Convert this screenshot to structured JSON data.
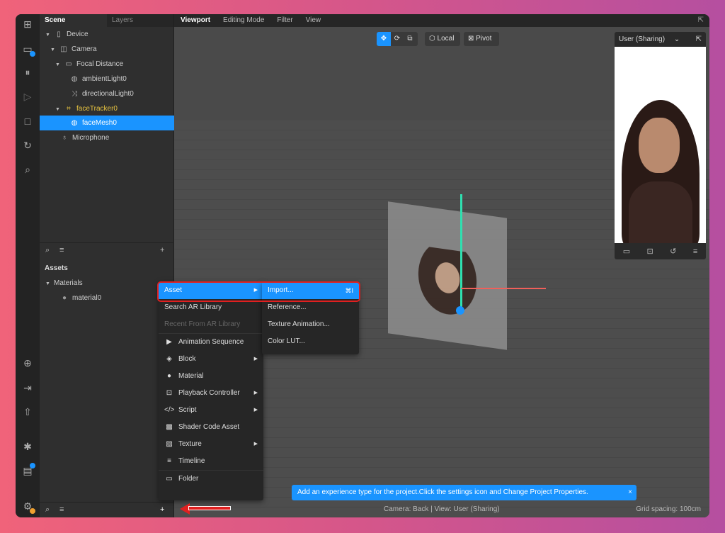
{
  "iconbar": {
    "icons": [
      "layout-icon",
      "camera-view-icon",
      "pause-icon",
      "step-play-icon",
      "square-icon",
      "refresh-icon",
      "search-icon",
      "add-folder-icon",
      "import-icon",
      "upload-icon",
      "bug-icon",
      "device-icon",
      "settings-icon"
    ],
    "accent": "#1a94ff",
    "warning": "#f0a030"
  },
  "scene": {
    "tabs": [
      "Scene",
      "Layers"
    ],
    "items": [
      {
        "label": "Device",
        "icon": "phone-icon"
      },
      {
        "label": "Camera",
        "icon": "camera-icon"
      },
      {
        "label": "Focal Distance",
        "icon": "ruler-icon"
      },
      {
        "label": "ambientLight0",
        "icon": "globe-icon"
      },
      {
        "label": "directionalLight0",
        "icon": "light-icon"
      },
      {
        "label": "faceTracker0",
        "icon": "face-tracker-icon"
      },
      {
        "label": "faceMesh0",
        "icon": "mesh-icon"
      },
      {
        "label": "Microphone",
        "icon": "microphone-icon"
      }
    ]
  },
  "assets": {
    "title": "Assets",
    "group": "Materials",
    "items": [
      "material0"
    ]
  },
  "viewport": {
    "tabs": [
      "Viewport",
      "Editing Mode",
      "Filter",
      "View"
    ],
    "local": "Local",
    "pivot": "Pivot",
    "status": "Camera: Back | View: User (Sharing)",
    "grid": "Grid spacing: 100cm",
    "notice": "Add an experience type for the project.Click the settings icon and Change Project Properties."
  },
  "preview": {
    "view": "User (Sharing)"
  },
  "menu": {
    "items": [
      {
        "label": "Asset",
        "sub": true
      },
      {
        "label": "Search AR Library"
      },
      {
        "label": "Recent From AR Library",
        "disabled": true
      },
      {
        "label": "Animation Sequence",
        "icon": "▶"
      },
      {
        "label": "Block",
        "icon": "◈",
        "sub": true
      },
      {
        "label": "Material",
        "icon": "●"
      },
      {
        "label": "Playback Controller",
        "icon": "⊡",
        "sub": true
      },
      {
        "label": "Script",
        "icon": "</>",
        "sub": true
      },
      {
        "label": "Shader Code Asset",
        "icon": "▩"
      },
      {
        "label": "Texture",
        "icon": "▨",
        "sub": true
      },
      {
        "label": "Timeline",
        "icon": "≡"
      },
      {
        "label": "Folder",
        "icon": "▭"
      }
    ],
    "submenu": [
      {
        "label": "Import...",
        "shortcut": "⌘I"
      },
      {
        "label": "Reference..."
      },
      {
        "label": "Texture Animation..."
      },
      {
        "label": "Color LUT..."
      }
    ]
  }
}
